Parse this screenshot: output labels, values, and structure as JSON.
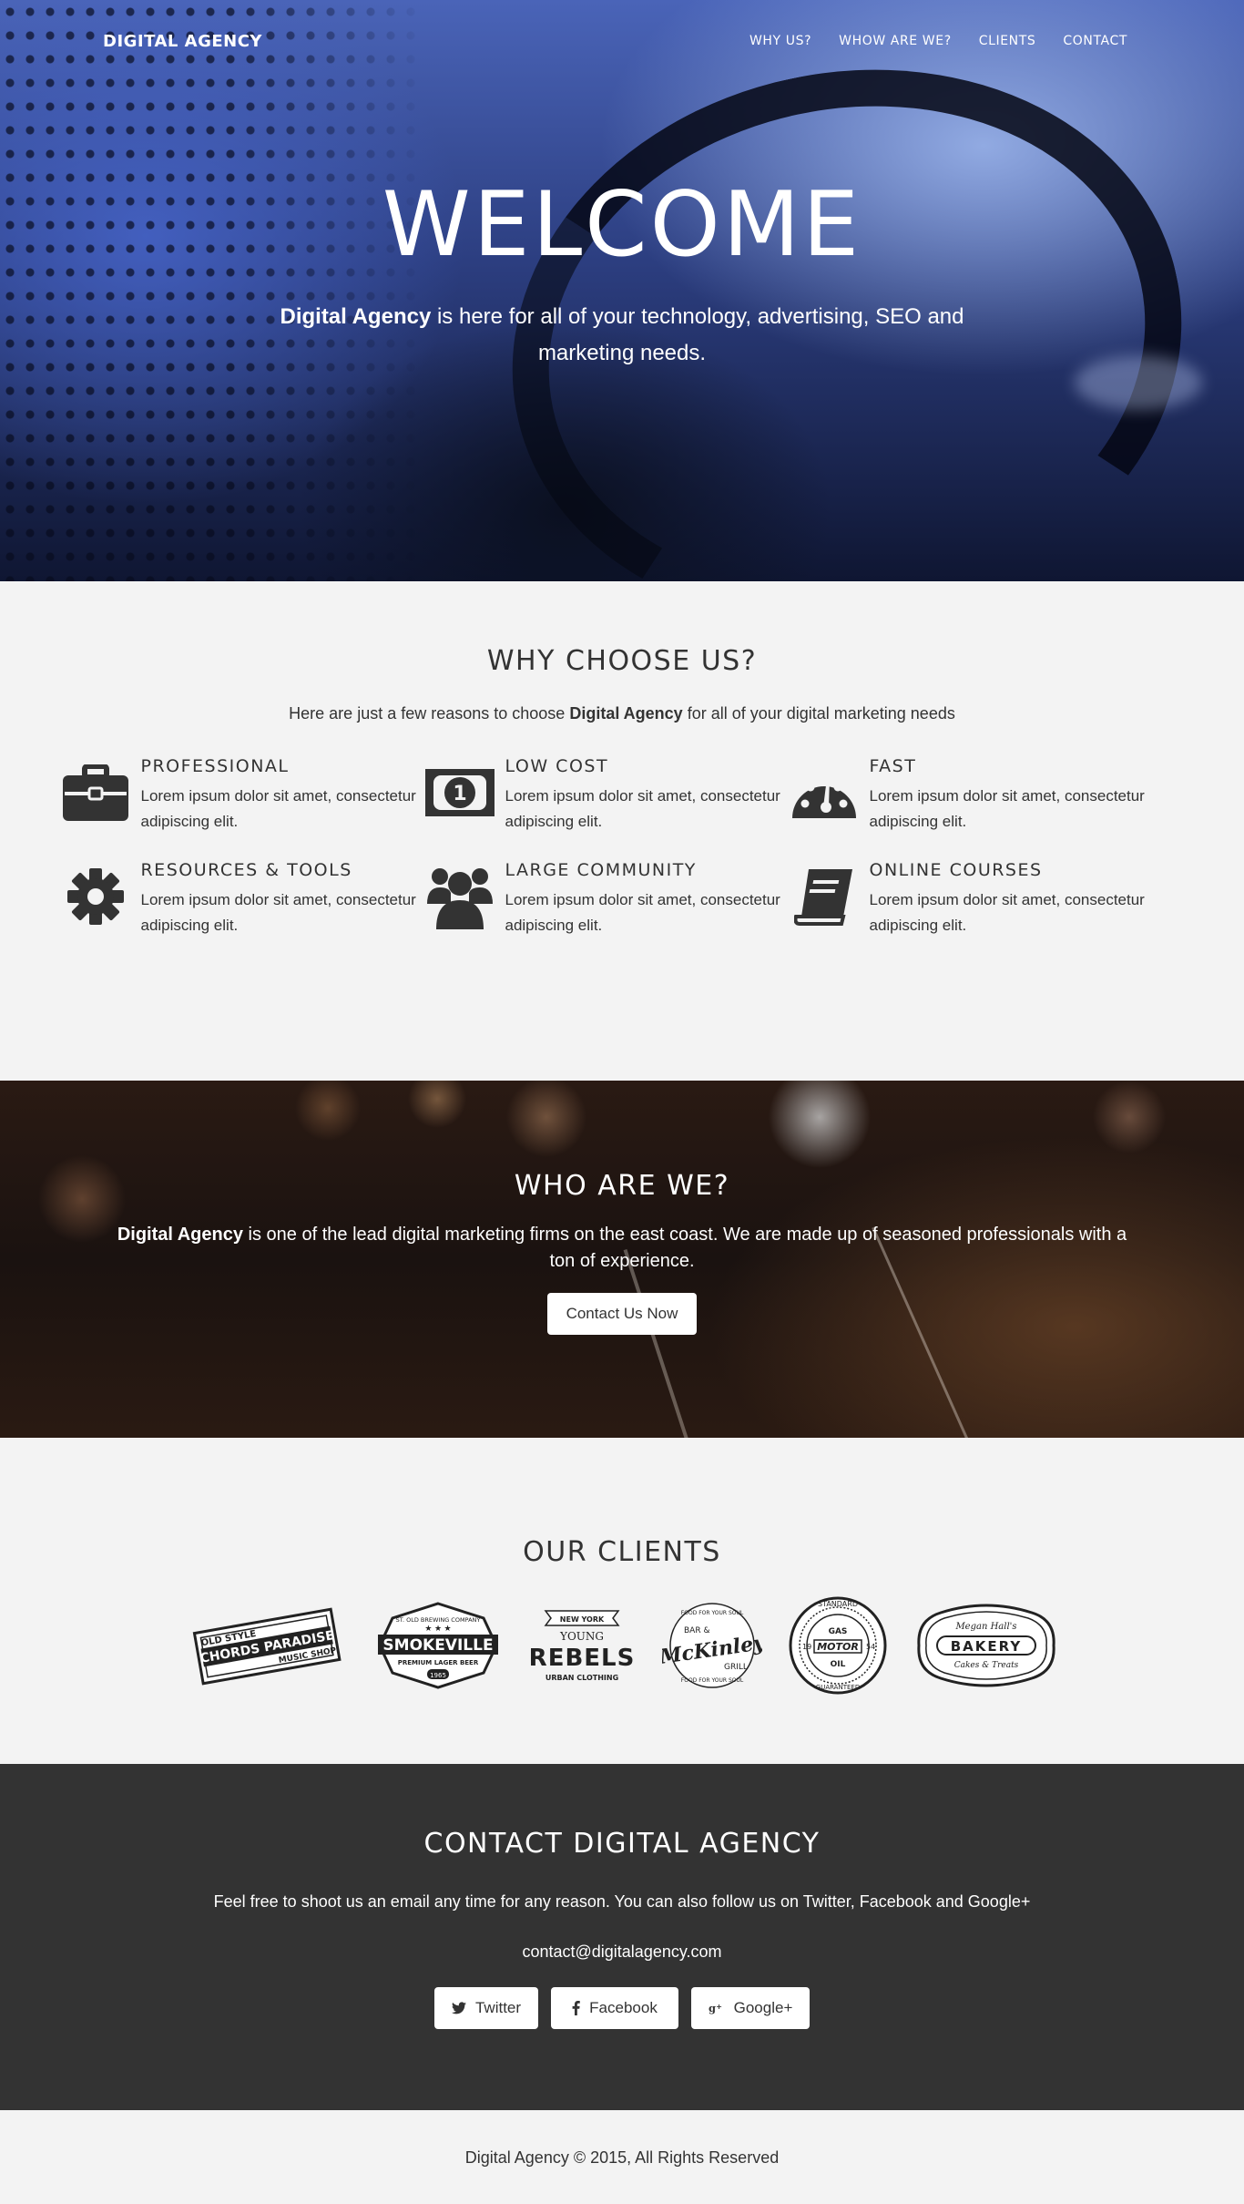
{
  "nav": {
    "brand": "DIGITAL AGENCY",
    "links": [
      "WHY US?",
      "WHOW ARE WE?",
      "CLIENTS",
      "CONTACT"
    ]
  },
  "hero": {
    "title": "WELCOME",
    "sub_bold": "Digital Agency",
    "sub_rest": " is here for all of your technology, advertising, SEO and marketing needs."
  },
  "why": {
    "title": "WHY CHOOSE US?",
    "intro_pre": "Here are just a few reasons to choose ",
    "intro_bold": "Digital Agency",
    "intro_post": " for all of your digital marketing needs",
    "features": [
      {
        "title": "PROFESSIONAL",
        "text": "Lorem ipsum dolor sit amet, consectetur adipiscing elit.",
        "icon": "briefcase-icon"
      },
      {
        "title": "LOW COST",
        "text": "Lorem ipsum dolor sit amet, consectetur adipiscing elit.",
        "icon": "money-icon"
      },
      {
        "title": "FAST",
        "text": "Lorem ipsum dolor sit amet, consectetur adipiscing elit.",
        "icon": "dashboard-icon"
      },
      {
        "title": "RESOURCES & TOOLS",
        "text": "Lorem ipsum dolor sit amet, consectetur adipiscing elit.",
        "icon": "gear-icon"
      },
      {
        "title": "LARGE COMMUNITY",
        "text": "Lorem ipsum dolor sit amet, consectetur adipiscing elit.",
        "icon": "users-icon"
      },
      {
        "title": "ONLINE COURSES",
        "text": "Lorem ipsum dolor sit amet, consectetur adipiscing elit.",
        "icon": "book-icon"
      }
    ]
  },
  "who": {
    "title": "WHO ARE WE?",
    "text_bold": "Digital Agency",
    "text_rest": " is one of the lead digital marketing firms on the east coast. We are made up of seasoned professionals with a ton of experience.",
    "button": "Contact Us Now"
  },
  "clients": {
    "title": "OUR CLIENTS",
    "logos": [
      {
        "name": "chords-paradise-logo",
        "lines": [
          "OLD STYLE",
          "CHORDS PARADISE",
          "MUSIC SHOP"
        ]
      },
      {
        "name": "smokeville-logo",
        "lines": [
          "ST. OLD BREWING COMPANY",
          "SMOKEVILLE",
          "PREMIUM LAGER BEER",
          "1965"
        ]
      },
      {
        "name": "young-rebels-logo",
        "lines": [
          "NEW YORK",
          "YOUNG",
          "REBELS",
          "URBAN CLOTHING"
        ]
      },
      {
        "name": "mckinley-logo",
        "lines": [
          "FOOD FOR YOUR SOUL",
          "BAR &",
          "McKinley",
          "GRILL",
          "FOOD FOR YOUR SOUL"
        ]
      },
      {
        "name": "motor-logo",
        "lines": [
          "STANDARD",
          "GAS",
          "19",
          "MOTOR",
          "54",
          "OIL",
          "GUARANTEED"
        ]
      },
      {
        "name": "bakery-logo",
        "lines": [
          "Megan Hall's",
          "BAKERY",
          "Cakes & Treats"
        ]
      }
    ]
  },
  "contact": {
    "title": "CONTACT DIGITAL AGENCY",
    "text": "Feel free to shoot us an email any time for any reason. You can also follow us on Twitter, Facebook and Google+",
    "email": "contact@digitalagency.com",
    "social": [
      {
        "label": "Twitter",
        "icon": "twitter-icon"
      },
      {
        "label": "Facebook",
        "icon": "facebook-icon"
      },
      {
        "label": "Google+",
        "icon": "google-plus-icon"
      }
    ]
  },
  "footer": {
    "text": "Digital Agency © 2015, All Rights Reserved"
  }
}
